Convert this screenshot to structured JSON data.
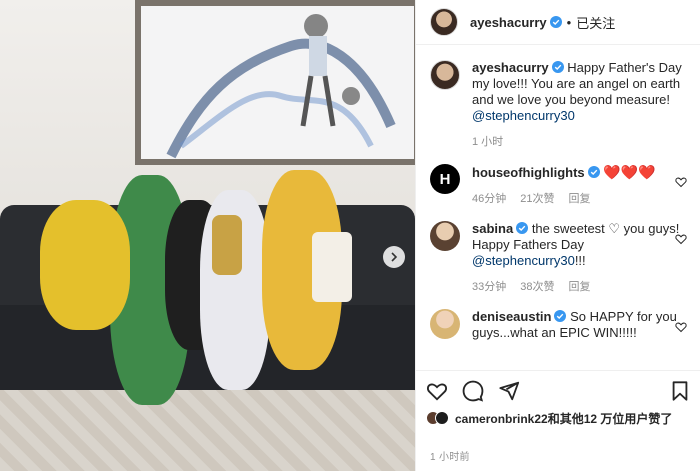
{
  "post": {
    "author": "ayeshacurry",
    "follow_dot": "•",
    "follow_label": "已关注",
    "caption_author": "ayeshacurry",
    "caption_text": "Happy Father's Day my love!!! You are an angel on earth and we love you beyond measure!",
    "caption_mention": "@stephencurry30",
    "caption_time": "1 小时"
  },
  "comments": [
    {
      "username": "houseofhighlights",
      "avatar_letter": "H",
      "hearts": "❤️❤️❤️",
      "time": "46分钟",
      "likes": "21次赞",
      "reply": "回复"
    },
    {
      "username": "sabina",
      "text": "the sweetest ♡ you guys! Happy Fathers Day",
      "mention": "@stephencurry30",
      "suffix": "!!!",
      "time": "33分钟",
      "likes": "38次赞",
      "reply": "回复"
    },
    {
      "username": "deniseaustin",
      "text": "So HAPPY for you guys...what an EPIC WIN!!!!!"
    }
  ],
  "likes_summary": {
    "text": "cameronbrink22和其他12 万位用户赞了"
  },
  "posted_time": "1 小时前",
  "colors": {
    "accent_link": "#00376b",
    "heart_red": "#ed4956",
    "verified_blue": "#3897f0",
    "secondary_text": "#8e8e8e"
  },
  "icons": {
    "like": "heart-icon",
    "comment": "comment-icon",
    "share": "share-icon",
    "save": "bookmark-icon",
    "verified": "verified-badge-icon",
    "next": "chevron-right-icon"
  }
}
